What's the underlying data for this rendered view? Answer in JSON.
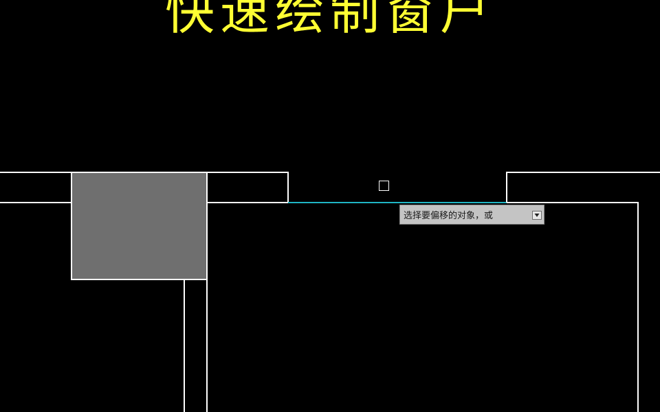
{
  "overlay": {
    "title": "快速绘制窗户",
    "title_color": "#ffff33"
  },
  "canvas": {
    "background_color": "#000000",
    "line_color": "#ffffff",
    "highlight_line_color": "#1fb5c4",
    "column_fill_color": "#6f6f6f"
  },
  "cursor": {
    "icon": "pickbox-icon"
  },
  "command_tooltip": {
    "prompt_text": "选择要偏移的对象，或",
    "icon": "down-arrow-icon"
  }
}
